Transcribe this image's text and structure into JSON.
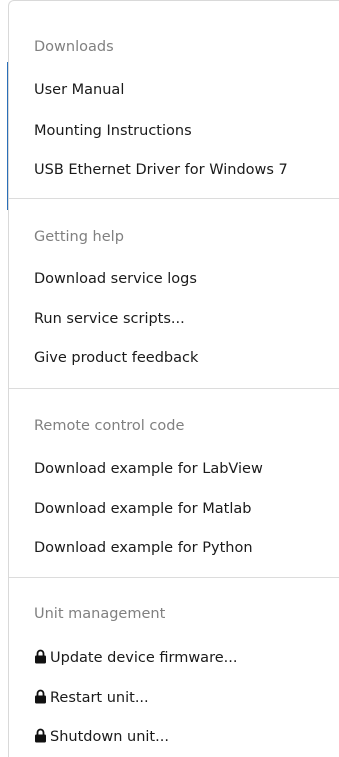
{
  "menu": {
    "sections": [
      {
        "heading": "Downloads",
        "items": [
          {
            "label": "User Manual"
          },
          {
            "label": "Mounting Instructions"
          },
          {
            "label": "USB Ethernet Driver for Windows 7"
          }
        ]
      },
      {
        "heading": "Getting help",
        "items": [
          {
            "label": "Download service logs"
          },
          {
            "label": "Run service scripts..."
          },
          {
            "label": "Give product feedback"
          }
        ]
      },
      {
        "heading": "Remote control code",
        "items": [
          {
            "label": "Download example for LabView"
          },
          {
            "label": "Download example for Matlab"
          },
          {
            "label": "Download example for Python"
          }
        ]
      },
      {
        "heading": "Unit management",
        "items": [
          {
            "label": "Update device firmware...",
            "icon": "lock-icon"
          },
          {
            "label": "Restart unit...",
            "icon": "lock-icon"
          },
          {
            "label": "Shutdown unit...",
            "icon": "lock-icon"
          }
        ]
      }
    ]
  },
  "colors": {
    "heading": "#808080",
    "item": "#1a1a1a",
    "accent": "#2a6fb8"
  }
}
